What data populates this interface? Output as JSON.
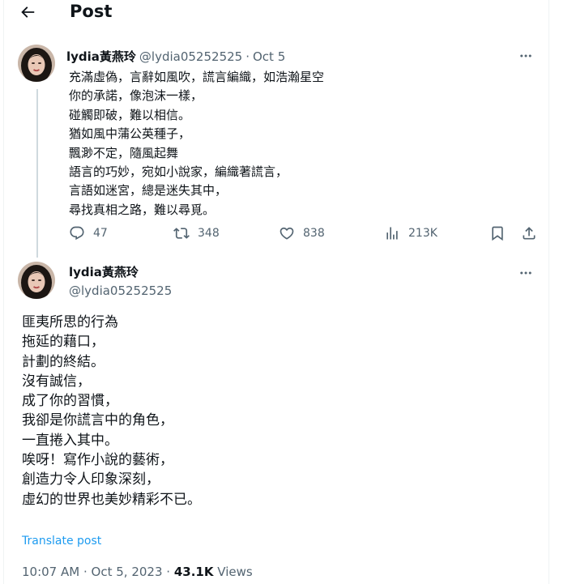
{
  "header": {
    "title": "Post",
    "back_icon": "arrow-left-icon"
  },
  "parent_post": {
    "display_name": "lydia黃燕玲",
    "handle": "@lydia05252525",
    "separator": "·",
    "date": "Oct 5",
    "lines": [
      "充滿虛偽，言辭如風吹，謊言編織，如浩瀚星空",
      "你的承諾，像泡沫一樣，",
      "碰觸即破，難以相信。",
      "猶如風中蒲公英種子，",
      "飄渺不定，隨風起舞",
      "語言的巧妙，宛如小說家，編織著謊言，",
      "言語如迷宮，總是迷失其中，",
      "尋找真相之路，難以尋覓。"
    ],
    "actions": {
      "replies": "47",
      "reposts": "348",
      "likes": "838",
      "views": "213K"
    }
  },
  "main_post": {
    "display_name": "lydia黃燕玲",
    "handle": "@lydia05252525",
    "lines": [
      "匪夷所思的行為",
      "拖延的藉口，",
      "計劃的終結。",
      "沒有誠信，",
      "成了你的習慣，",
      "我卻是你謊言中的角色，",
      "一直捲入其中。",
      "唉呀！寫作小說的藝術，",
      "創造力令人印象深刻，",
      "虛幻的世界也美妙精彩不已。"
    ],
    "translate_label": "Translate post",
    "time": "10:07 AM",
    "separator": "·",
    "date": "Oct 5, 2023",
    "views_count": "43.1K",
    "views_label": "Views"
  },
  "colors": {
    "text_primary": "#0f1419",
    "text_secondary": "#536471",
    "link": "#1d9bf0",
    "thread_line": "#cfd9de",
    "border": "#eff3f4"
  }
}
